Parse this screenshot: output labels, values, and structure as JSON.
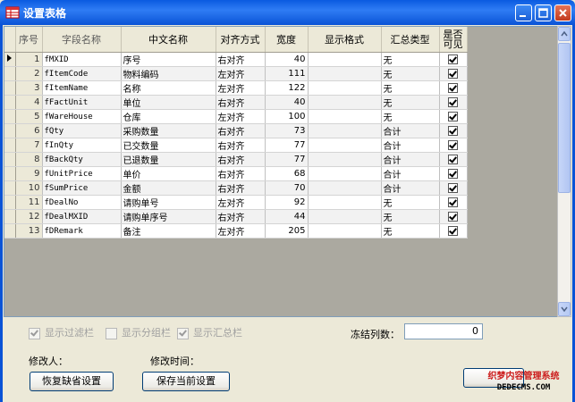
{
  "window": {
    "title": "设置表格"
  },
  "columns": [
    "序号",
    "字段名称",
    "中文名称",
    "对齐方式",
    "宽度",
    "显示格式",
    "汇总类型",
    "是否可见"
  ],
  "rows": [
    {
      "no": "1",
      "field": "fMXID",
      "cn": "序号",
      "align": "右对齐",
      "width": "40",
      "fmt": "",
      "sum": "无",
      "visible": true
    },
    {
      "no": "2",
      "field": "fItemCode",
      "cn": "物料编码",
      "align": "左对齐",
      "width": "111",
      "fmt": "",
      "sum": "无",
      "visible": true
    },
    {
      "no": "3",
      "field": "fItemName",
      "cn": "名称",
      "align": "左对齐",
      "width": "122",
      "fmt": "",
      "sum": "无",
      "visible": true
    },
    {
      "no": "4",
      "field": "fFactUnit",
      "cn": "单位",
      "align": "右对齐",
      "width": "40",
      "fmt": "",
      "sum": "无",
      "visible": true
    },
    {
      "no": "5",
      "field": "fWareHouse",
      "cn": "仓库",
      "align": "左对齐",
      "width": "100",
      "fmt": "",
      "sum": "无",
      "visible": true
    },
    {
      "no": "6",
      "field": "fQty",
      "cn": "采购数量",
      "align": "右对齐",
      "width": "73",
      "fmt": "",
      "sum": "合计",
      "visible": true
    },
    {
      "no": "7",
      "field": "fInQty",
      "cn": "已交数量",
      "align": "右对齐",
      "width": "77",
      "fmt": "",
      "sum": "合计",
      "visible": true
    },
    {
      "no": "8",
      "field": "fBackQty",
      "cn": "已退数量",
      "align": "右对齐",
      "width": "77",
      "fmt": "",
      "sum": "合计",
      "visible": true
    },
    {
      "no": "9",
      "field": "fUnitPrice",
      "cn": "单价",
      "align": "右对齐",
      "width": "68",
      "fmt": "",
      "sum": "合计",
      "visible": true
    },
    {
      "no": "10",
      "field": "fSumPrice",
      "cn": "金额",
      "align": "右对齐",
      "width": "70",
      "fmt": "",
      "sum": "合计",
      "visible": true
    },
    {
      "no": "11",
      "field": "fDealNo",
      "cn": "请购单号",
      "align": "左对齐",
      "width": "92",
      "fmt": "",
      "sum": "无",
      "visible": true
    },
    {
      "no": "12",
      "field": "fDealMXID",
      "cn": "请购单序号",
      "align": "右对齐",
      "width": "44",
      "fmt": "",
      "sum": "无",
      "visible": true
    },
    {
      "no": "13",
      "field": "fDRemark",
      "cn": "备注",
      "align": "左对齐",
      "width": "205",
      "fmt": "",
      "sum": "无",
      "visible": true
    }
  ],
  "options": {
    "filter_bar": {
      "label": "显示过滤栏",
      "checked": true
    },
    "group_bar": {
      "label": "显示分组栏",
      "checked": false
    },
    "summary_bar": {
      "label": "显示汇总栏",
      "checked": true
    }
  },
  "freeze": {
    "label": "冻结列数：",
    "value": "0"
  },
  "modifier_label": "修改人：",
  "modify_time_label": "修改时间：",
  "buttons": {
    "restore": "恢复缺省设置",
    "save": "保存当前设置"
  },
  "watermark": {
    "line1": "织梦内容管理系统",
    "line2": "DEDECMS.COM"
  }
}
